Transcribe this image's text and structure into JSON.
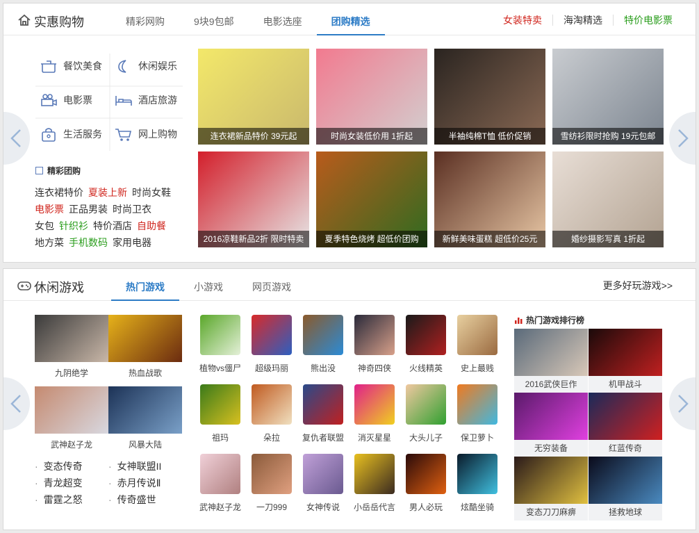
{
  "shopping": {
    "title": "实惠购物",
    "tabs": [
      "精彩网购",
      "9块9包邮",
      "电影选座",
      "团购精选"
    ],
    "active_tab": 3,
    "right_links": [
      {
        "label": "女装特卖",
        "color": "#d0261e"
      },
      {
        "label": "海淘精选",
        "color": "#333333"
      },
      {
        "label": "特价电影票",
        "color": "#2a9d1c"
      }
    ],
    "categories": [
      {
        "label": "餐饮美食",
        "icon": "pot-icon"
      },
      {
        "label": "休闲娱乐",
        "icon": "moon-icon"
      },
      {
        "label": "电影票",
        "icon": "movie-camera-icon"
      },
      {
        "label": "酒店旅游",
        "icon": "bed-icon"
      },
      {
        "label": "生活服务",
        "icon": "bag-icon"
      },
      {
        "label": "网上购物",
        "icon": "cart-icon"
      }
    ],
    "subhead": "精彩团购",
    "link_rows": [
      [
        {
          "t": "连衣裙特价",
          "c": "#333"
        },
        {
          "t": "夏装上新",
          "c": "#d0261e"
        },
        {
          "t": "时尚女鞋",
          "c": "#333"
        }
      ],
      [
        {
          "t": "电影票",
          "c": "#d0261e"
        },
        {
          "t": "正品男装",
          "c": "#333"
        },
        {
          "t": "时尚卫衣",
          "c": "#333"
        }
      ],
      [
        {
          "t": "女包",
          "c": "#333"
        },
        {
          "t": "针织衫",
          "c": "#2a9d1c"
        },
        {
          "t": "特价酒店",
          "c": "#333"
        },
        {
          "t": "自助餐",
          "c": "#d0261e"
        }
      ],
      [
        {
          "t": "地方菜",
          "c": "#333"
        },
        {
          "t": "手机数码",
          "c": "#2a9d1c"
        },
        {
          "t": "家用电器",
          "c": "#333"
        }
      ]
    ],
    "thumbs": [
      {
        "caption": "连衣裙新品特价 39元起",
        "c1": "#f3e86a",
        "c2": "#c9b86d"
      },
      {
        "caption": "时尚女装低价用 1折起",
        "c1": "#f27a8f",
        "c2": "#d2d0d0"
      },
      {
        "caption": "半袖纯棉T恤 低价促销",
        "c1": "#2a2420",
        "c2": "#8b6a55"
      },
      {
        "caption": "雪纺衫限时抢购 19元包邮",
        "c1": "#c9ccd0",
        "c2": "#7c8590"
      },
      {
        "caption": "2016凉鞋新品2折 限时特卖",
        "c1": "#d31f2b",
        "c2": "#e6e6e6"
      },
      {
        "caption": "夏季特色烧烤 超低价团购",
        "c1": "#b95b1c",
        "c2": "#2f6b20"
      },
      {
        "caption": "新鲜美味蛋糕 超低价25元",
        "c1": "#5a2f22",
        "c2": "#e8c7a5"
      },
      {
        "caption": "婚纱摄影写真 1折起",
        "c1": "#e8ded6",
        "c2": "#b3a392"
      }
    ]
  },
  "games": {
    "title": "休闲游戏",
    "tabs": [
      "热门游戏",
      "小游戏",
      "网页游戏"
    ],
    "active_tab": 0,
    "more": "更多好玩游戏>>",
    "big_cards": [
      {
        "label": "九阴绝学",
        "c1": "#3a3a3a",
        "c2": "#c9b7a8"
      },
      {
        "label": "热血战歌",
        "c1": "#e6b21a",
        "c2": "#6b2b10"
      },
      {
        "label": "武神赵子龙",
        "c1": "#c58a70",
        "c2": "#d8d8e0"
      },
      {
        "label": "风暴大陆",
        "c1": "#1c3256",
        "c2": "#7aa0c8"
      }
    ],
    "bullets_left": [
      "变态传奇",
      "青龙超变",
      "雷霆之怒"
    ],
    "bullets_right": [
      "女神联盟II",
      "赤月传说Ⅱ",
      "传奇盛世"
    ],
    "small": [
      {
        "label": "植物vs僵尸",
        "c1": "#5aa72a",
        "c2": "#e4f0d8"
      },
      {
        "label": "超级玛丽",
        "c1": "#d82a2a",
        "c2": "#2d5fc0"
      },
      {
        "label": "熊出没",
        "c1": "#8b5a2b",
        "c2": "#2b8bd6"
      },
      {
        "label": "神奇四侠",
        "c1": "#2a2a3a",
        "c2": "#d8a08a"
      },
      {
        "label": "火线精英",
        "c1": "#1a1a1a",
        "c2": "#b02020"
      },
      {
        "label": "史上最贱",
        "c1": "#e8d0a0",
        "c2": "#9a6a40"
      },
      {
        "label": "祖玛",
        "c1": "#3a7a1a",
        "c2": "#d8c020"
      },
      {
        "label": "朵拉",
        "c1": "#c05a20",
        "c2": "#f0e0c0"
      },
      {
        "label": "复仇者联盟",
        "c1": "#2a4a8a",
        "c2": "#c02020"
      },
      {
        "label": "消灭星星",
        "c1": "#e0208a",
        "c2": "#f0d020"
      },
      {
        "label": "大头儿子",
        "c1": "#f0c8a0",
        "c2": "#30a030"
      },
      {
        "label": "保卫萝卜",
        "c1": "#f07a20",
        "c2": "#40b8e0"
      },
      {
        "label": "武神赵子龙",
        "c1": "#f0d0d8",
        "c2": "#b08080"
      },
      {
        "label": "一刀999",
        "c1": "#8a5a3a",
        "c2": "#e0a080"
      },
      {
        "label": "女神传说",
        "c1": "#c0a0d8",
        "c2": "#6a5a90"
      },
      {
        "label": "小岳岳代言",
        "c1": "#e8c020",
        "c2": "#3a2a20"
      },
      {
        "label": "男人必玩",
        "c1": "#2a0a0a",
        "c2": "#e06010"
      },
      {
        "label": "炫酷坐骑",
        "c1": "#0a1a2a",
        "c2": "#40c0e0"
      }
    ],
    "rank_title": "热门游戏排行榜",
    "ranks": [
      {
        "label": "2016武侠巨作",
        "c1": "#5a6a7a",
        "c2": "#d8c8b8"
      },
      {
        "label": "机甲战斗",
        "c1": "#1a0a0a",
        "c2": "#c02020"
      },
      {
        "label": "无穷装备",
        "c1": "#5a1a6a",
        "c2": "#e040e0"
      },
      {
        "label": "红蓝传奇",
        "c1": "#1a2a5a",
        "c2": "#d02020"
      },
      {
        "label": "变态刀刀麻痹",
        "c1": "#2a1a1a",
        "c2": "#e0c040"
      },
      {
        "label": "拯救地球",
        "c1": "#0a0a1a",
        "c2": "#4a8ac0"
      }
    ]
  }
}
